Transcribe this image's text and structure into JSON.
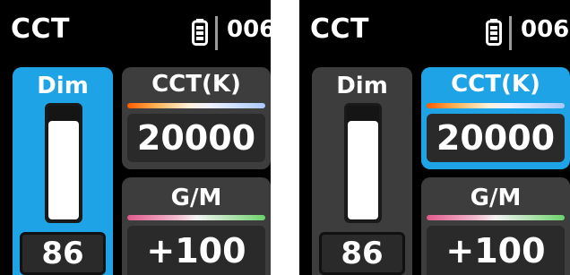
{
  "screens": [
    {
      "header": {
        "title": "CCT",
        "channel": "006",
        "battery_icon": "battery-icon"
      },
      "dim": {
        "label": "Dim",
        "value": "86",
        "level": 0.86,
        "selected": true
      },
      "cct": {
        "label": "CCT(K)",
        "value": "20000",
        "selected": false
      },
      "gm": {
        "label": "G/M",
        "value": "+100"
      }
    },
    {
      "header": {
        "title": "CCT",
        "channel": "006",
        "battery_icon": "battery-icon"
      },
      "dim": {
        "label": "Dim",
        "value": "86",
        "level": 0.86,
        "selected": false
      },
      "cct": {
        "label": "CCT(K)",
        "value": "20000",
        "selected": true
      },
      "gm": {
        "label": "G/M",
        "value": "+100"
      }
    }
  ],
  "colors": {
    "accent": "#1ea3e6",
    "panel": "#3d3d3d",
    "background": "#000000"
  }
}
